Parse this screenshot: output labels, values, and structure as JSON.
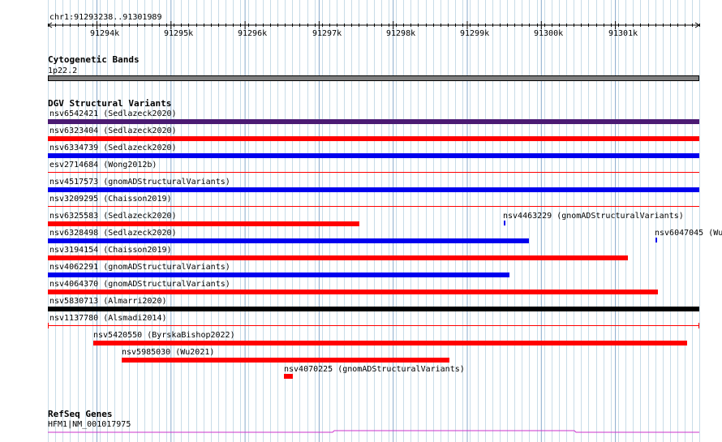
{
  "ruler": {
    "region": "chr1:91293238..91301989",
    "ticks": [
      "91294k",
      "91295k",
      "91296k",
      "91297k",
      "91298k",
      "91299k",
      "91300k",
      "91301k"
    ]
  },
  "cytoband": {
    "title": "Cytogenetic Bands",
    "band": "1p22.2",
    "color": "#808080"
  },
  "dgv": {
    "title": "DGV Structural Variants",
    "variants": [
      {
        "label": "nsv6542421 (Sedlazeck2020)",
        "color": "#4b1a73"
      },
      {
        "label": "nsv6323404 (Sedlazeck2020)",
        "color": "#ff0000"
      },
      {
        "label": "nsv6334739 (Sedlazeck2020)",
        "color": "#0000ee"
      },
      {
        "label": "esv2714684 (Wong2012b)",
        "color": "#ff0000"
      },
      {
        "label": "nsv4517573 (gnomADStructuralVariants)",
        "color": "#0000ee"
      },
      {
        "label": "nsv3209295 (Chaisson2019)",
        "color": "#ff0000"
      },
      {
        "label": "nsv6325583 (Sedlazeck2020)",
        "color": "#ff0000"
      },
      {
        "label": "nsv4463229 (gnomADStructuralVariants)",
        "color": "#0000ee"
      },
      {
        "label": "nsv6328498 (Sedlazeck2020)",
        "color": "#0000ee"
      },
      {
        "label": "nsv6047045 (Wu",
        "color": "#0000ee"
      },
      {
        "label": "nsv3194154 (Chaisson2019)",
        "color": "#ff0000"
      },
      {
        "label": "nsv4062291 (gnomADStructuralVariants)",
        "color": "#0000ee"
      },
      {
        "label": "nsv4064370 (gnomADStructuralVariants)",
        "color": "#ff0000"
      },
      {
        "label": "nsv5830713 (Almarri2020)",
        "color": "#000000"
      },
      {
        "label": "nsv1137780 (Alsmadi2014)",
        "color": "#ff0000"
      },
      {
        "label": "nsv5420550 (ByrskaBishop2022)",
        "color": "#ff0000"
      },
      {
        "label": "nsv5985030 (Wu2021)",
        "color": "#ff0000"
      },
      {
        "label": "nsv4070225 (gnomADStructuralVariants)",
        "color": "#ff0000"
      }
    ]
  },
  "refseq": {
    "title": "RefSeq Genes",
    "gene": "HFM1|NM_001017975",
    "color": "#cc33cc"
  },
  "colors": {
    "grid_light": "#c8dce8",
    "grid_dark": "#88aacc"
  }
}
